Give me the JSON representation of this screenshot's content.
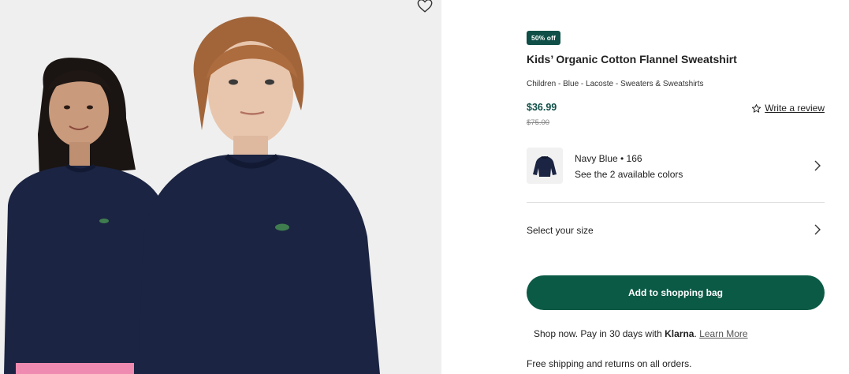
{
  "product": {
    "badge": "50% off",
    "title": "Kids’ Organic Cotton Flannel Sweatshirt",
    "breadcrumb": "Children - Blue - Lacoste - Sweaters & Sweatshirts",
    "price": "$36.99",
    "old_price": "$75.00",
    "review_label": "Write a review"
  },
  "color": {
    "name": "Navy Blue • 166",
    "available": "See the 2 available colors"
  },
  "size": {
    "label": "Select your size"
  },
  "actions": {
    "add_to_bag": "Add to shopping bag"
  },
  "payment": {
    "prefix": "Shop now. Pay in 30 days with",
    "brand": "Klarna",
    "suffix": ".",
    "learn_more": "Learn More"
  },
  "shipping": {
    "text": "Free shipping and returns on all orders."
  },
  "icons": {
    "wishlist": "heart-icon",
    "review": "star-icon",
    "chevron": "chevron-right-icon"
  },
  "colors": {
    "accent": "#0b5a45",
    "badge": "#0f4f47",
    "price": "#0f4f47",
    "garment": "#1b2442"
  }
}
